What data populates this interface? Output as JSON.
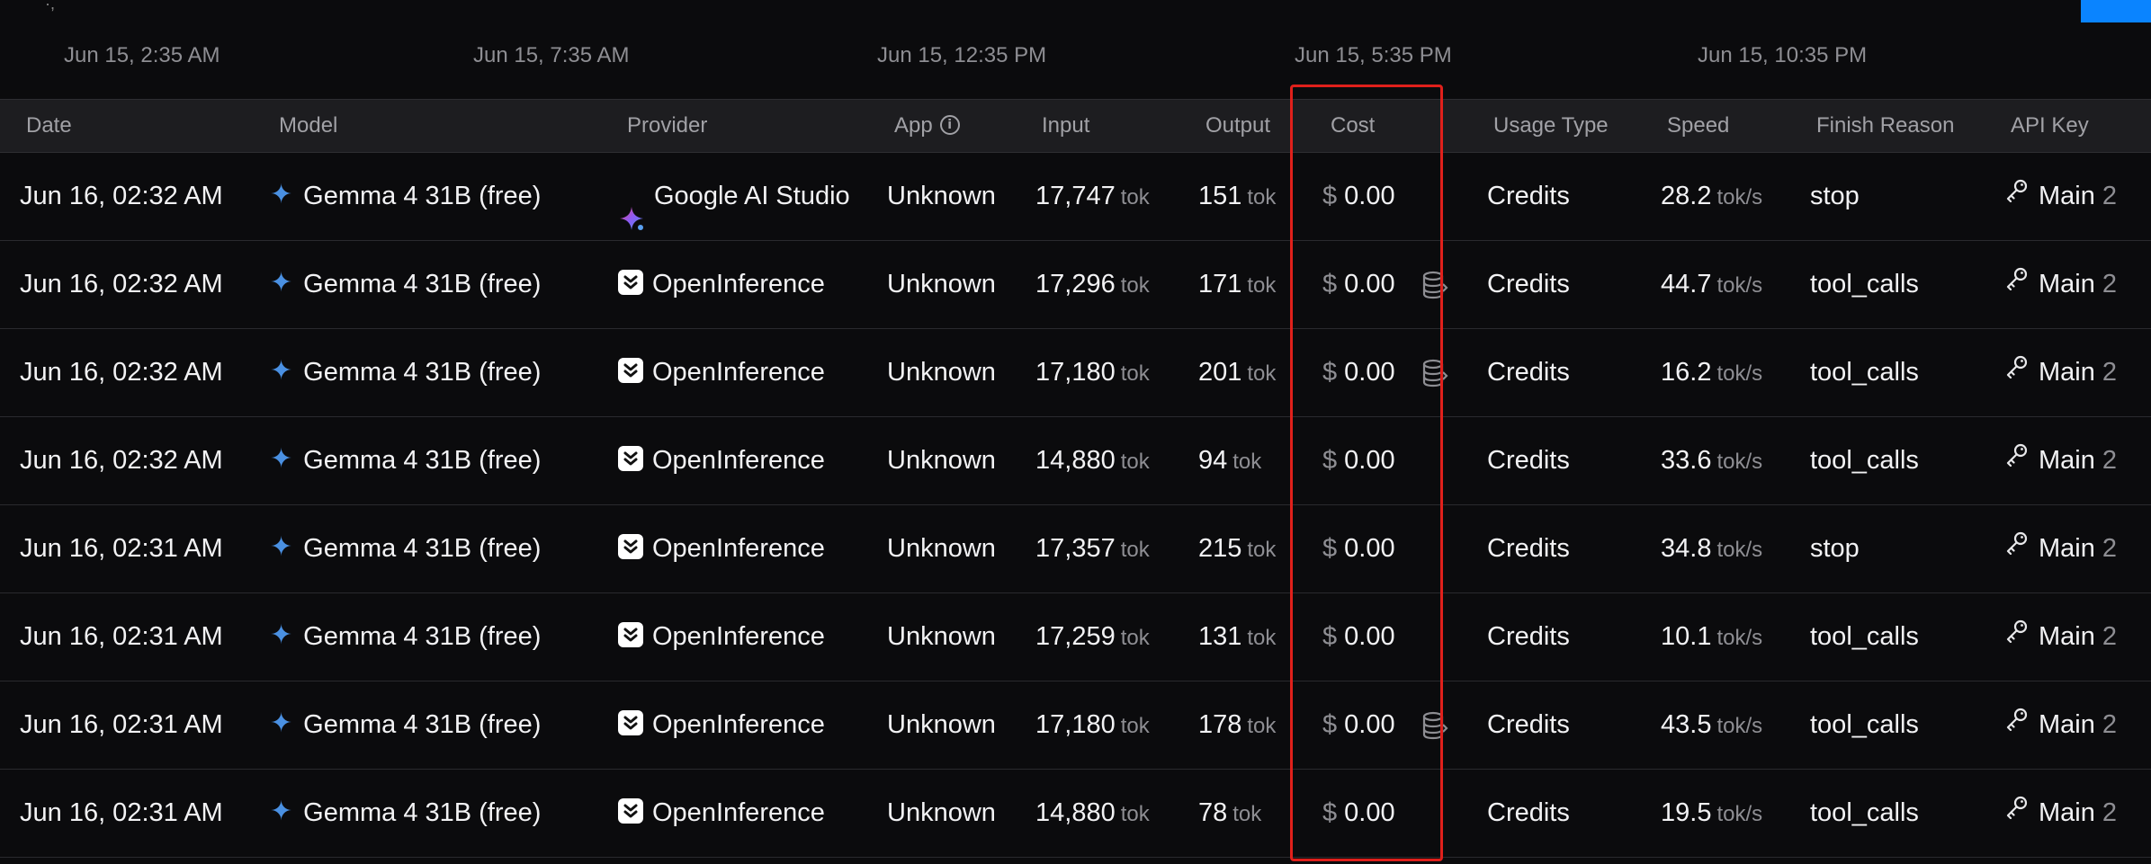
{
  "timeline": {
    "labels": [
      "Jun 15, 2:35 AM",
      "Jun 15, 7:35 AM",
      "Jun 15, 12:35 PM",
      "Jun 15, 5:35 PM",
      "Jun 15, 10:35 PM"
    ]
  },
  "columns": {
    "date": "Date",
    "model": "Model",
    "provider": "Provider",
    "app": "App",
    "input": "Input",
    "output": "Output",
    "cost": "Cost",
    "usage_type": "Usage Type",
    "speed": "Speed",
    "finish_reason": "Finish Reason",
    "api_key": "API Key"
  },
  "units": {
    "tok": "tok",
    "speed": "tok/s",
    "currency": "$"
  },
  "rows": [
    {
      "date": "Jun 16, 02:32 AM",
      "model": "Gemma 4 31B (free)",
      "provider": "Google AI Studio",
      "provider_icon": "google-ai-studio-icon",
      "app": "Unknown",
      "input": "17,747",
      "output": "151",
      "cost": "0.00",
      "db": false,
      "usage": "Credits",
      "speed": "28.2",
      "finish": "stop",
      "key": "Main",
      "key_num": "2"
    },
    {
      "date": "Jun 16, 02:32 AM",
      "model": "Gemma 4 31B (free)",
      "provider": "OpenInference",
      "provider_icon": "openinference-icon",
      "app": "Unknown",
      "input": "17,296",
      "output": "171",
      "cost": "0.00",
      "db": true,
      "usage": "Credits",
      "speed": "44.7",
      "finish": "tool_calls",
      "key": "Main",
      "key_num": "2"
    },
    {
      "date": "Jun 16, 02:32 AM",
      "model": "Gemma 4 31B (free)",
      "provider": "OpenInference",
      "provider_icon": "openinference-icon",
      "app": "Unknown",
      "input": "17,180",
      "output": "201",
      "cost": "0.00",
      "db": true,
      "usage": "Credits",
      "speed": "16.2",
      "finish": "tool_calls",
      "key": "Main",
      "key_num": "2"
    },
    {
      "date": "Jun 16, 02:32 AM",
      "model": "Gemma 4 31B (free)",
      "provider": "OpenInference",
      "provider_icon": "openinference-icon",
      "app": "Unknown",
      "input": "14,880",
      "output": "94",
      "cost": "0.00",
      "db": false,
      "usage": "Credits",
      "speed": "33.6",
      "finish": "tool_calls",
      "key": "Main",
      "key_num": "2"
    },
    {
      "date": "Jun 16, 02:31 AM",
      "model": "Gemma 4 31B (free)",
      "provider": "OpenInference",
      "provider_icon": "openinference-icon",
      "app": "Unknown",
      "input": "17,357",
      "output": "215",
      "cost": "0.00",
      "db": false,
      "usage": "Credits",
      "speed": "34.8",
      "finish": "stop",
      "key": "Main",
      "key_num": "2"
    },
    {
      "date": "Jun 16, 02:31 AM",
      "model": "Gemma 4 31B (free)",
      "provider": "OpenInference",
      "provider_icon": "openinference-icon",
      "app": "Unknown",
      "input": "17,259",
      "output": "131",
      "cost": "0.00",
      "db": false,
      "usage": "Credits",
      "speed": "10.1",
      "finish": "tool_calls",
      "key": "Main",
      "key_num": "2"
    },
    {
      "date": "Jun 16, 02:31 AM",
      "model": "Gemma 4 31B (free)",
      "provider": "OpenInference",
      "provider_icon": "openinference-icon",
      "app": "Unknown",
      "input": "17,180",
      "output": "178",
      "cost": "0.00",
      "db": true,
      "usage": "Credits",
      "speed": "43.5",
      "finish": "tool_calls",
      "key": "Main",
      "key_num": "2"
    },
    {
      "date": "Jun 16, 02:31 AM",
      "model": "Gemma 4 31B (free)",
      "provider": "OpenInference",
      "provider_icon": "openinference-icon",
      "app": "Unknown",
      "input": "14,880",
      "output": "78",
      "cost": "0.00",
      "db": false,
      "usage": "Credits",
      "speed": "19.5",
      "finish": "tool_calls",
      "key": "Main",
      "key_num": "2"
    }
  ],
  "colors": {
    "background": "#0b0b0d",
    "header_bg": "#1d1d20",
    "accent_blue": "#0a84ff",
    "model_star": "#4a90e2",
    "highlight_box": "#e0201b"
  }
}
